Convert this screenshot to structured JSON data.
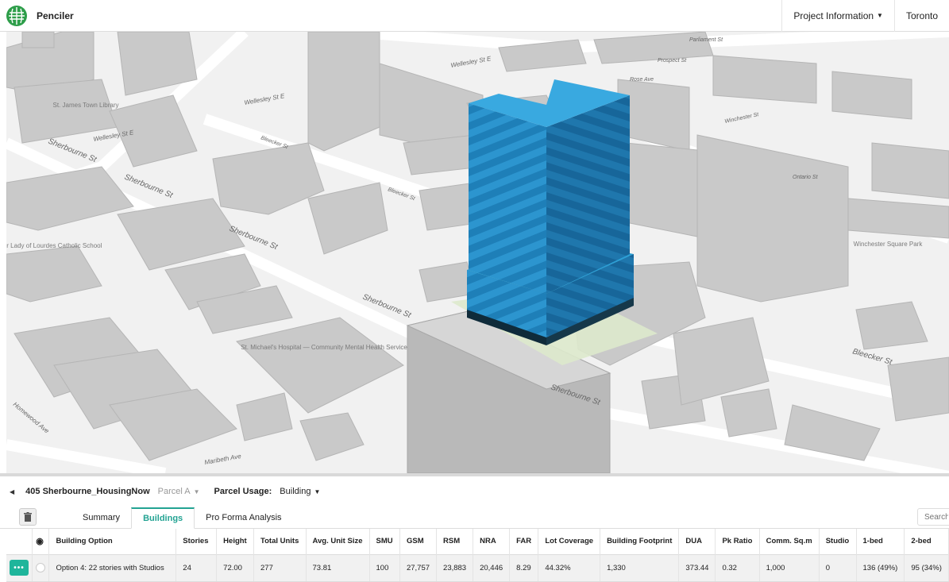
{
  "app": {
    "name": "Penciler"
  },
  "topbar": {
    "project_info": "Project Information",
    "city": "Toronto"
  },
  "map": {
    "streets": [
      "Sherbourne St",
      "Sherbourne St",
      "Sherbourne St",
      "Sherbourne St",
      "Sherbourne St",
      "Bleecker St",
      "Bleecker St",
      "Bleecker St",
      "Wellesley St E",
      "Wellesley St E",
      "Wellesley St E",
      "Homewood Ave",
      "Maribeth Ave",
      "Ontario St",
      "Winchester St",
      "Parliament St",
      "Prospect St",
      "Rose Ave"
    ],
    "places": [
      "St. Michael's Hospital — Community Mental Health Service",
      "Winchester Square Park",
      "Our Lady of Lourdes Catholic School",
      "St. James Town Library"
    ]
  },
  "panel": {
    "project_name": "405 Sherbourne_HousingNow",
    "parcel": "Parcel A",
    "usage_label": "Parcel Usage:",
    "usage_value": "Building",
    "tabs": [
      "Summary",
      "Buildings",
      "Pro Forma Analysis"
    ],
    "search_placeholder": "Search"
  },
  "table": {
    "headers": [
      "Building Option",
      "Stories",
      "Height",
      "Total Units",
      "Avg. Unit Size",
      "SMU",
      "GSM",
      "RSM",
      "NRA",
      "FAR",
      "Lot Coverage",
      "Building Footprint",
      "DUA",
      "Pk Ratio",
      "Comm. Sq.m",
      "Studio",
      "1-bed",
      "2-bed"
    ],
    "rows": [
      [
        "Option 4: 22 stories with Studios",
        "24",
        "72.00",
        "277",
        "73.81",
        "100",
        "27,757",
        "23,883",
        "20,446",
        "8.29",
        "44.32%",
        "1,330",
        "373.44",
        "0.32",
        "1,000",
        "0",
        "136 (49%)",
        "95 (34%)"
      ]
    ]
  },
  "colors": {
    "accent": "#23a393",
    "building": "#2a8fc8",
    "more_button": "#1fb59b"
  }
}
